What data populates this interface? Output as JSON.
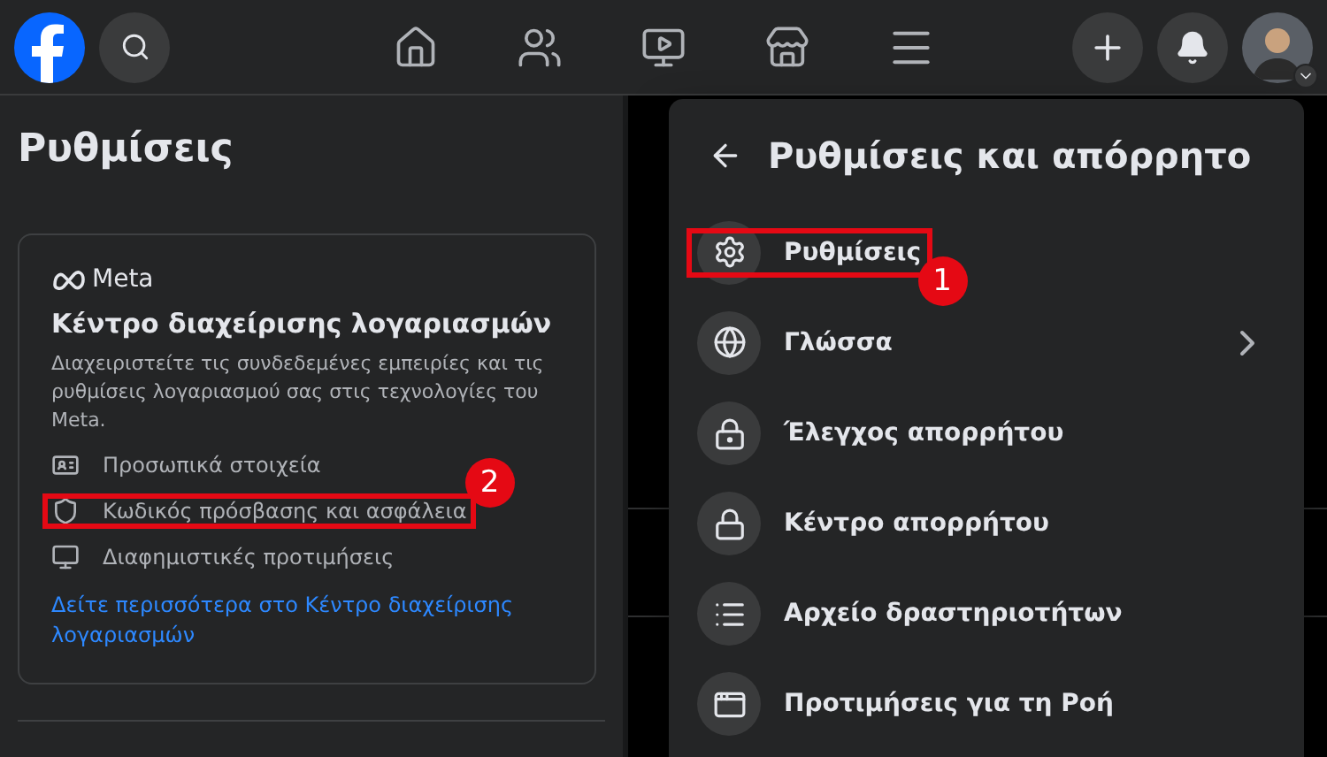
{
  "page_title": "Ρυθμίσεις",
  "accounts_center": {
    "brand": "Meta",
    "title": "Κέντρο διαχείρισης λογαριασμών",
    "description": "Διαχειριστείτε τις συνδεδεμένες εμπειρίες και τις ρυθμίσεις λογαριασμού σας στις τεχνολογίες του Meta.",
    "items": [
      {
        "label": "Προσωπικά στοιχεία"
      },
      {
        "label": "Κωδικός πρόσβασης και ασφάλεια",
        "callout": "2"
      },
      {
        "label": "Διαφημιστικές προτιμήσεις"
      }
    ],
    "link": "Δείτε περισσότερα στο Κέντρο διαχείρισης λογαριασμών"
  },
  "menu": {
    "title": "Ρυθμίσεις και απόρρητο",
    "items": [
      {
        "label": "Ρυθμίσεις",
        "submenu": false,
        "callout": "1"
      },
      {
        "label": "Γλώσσα",
        "submenu": true
      },
      {
        "label": "Έλεγχος απορρήτου",
        "submenu": false
      },
      {
        "label": "Κέντρο απορρήτου",
        "submenu": false
      },
      {
        "label": "Αρχείο δραστηριοτήτων",
        "submenu": false
      },
      {
        "label": "Προτιμήσεις για τη Ροή",
        "submenu": false
      }
    ]
  }
}
